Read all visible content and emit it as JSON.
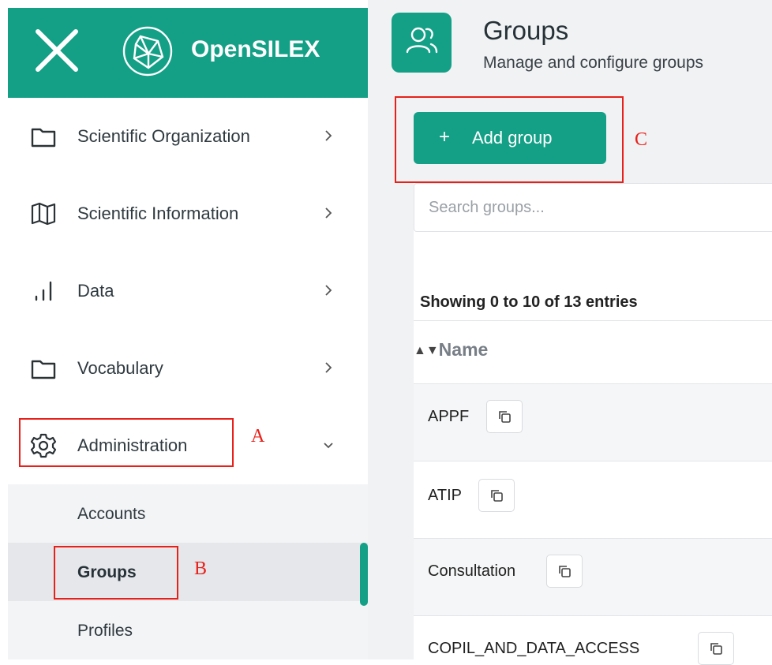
{
  "brand": {
    "name": "OpenSILEX",
    "close_icon": "close-icon",
    "logo_icon": "opensilex-logo-icon",
    "color": "#14a086"
  },
  "sidebar": {
    "items": [
      {
        "label": "Scientific Organization",
        "icon": "folder-icon",
        "chevron": "chevron-right-icon"
      },
      {
        "label": "Scientific Information",
        "icon": "map-icon",
        "chevron": "chevron-right-icon"
      },
      {
        "label": "Data",
        "icon": "bar-chart-icon",
        "chevron": "chevron-right-icon"
      },
      {
        "label": "Vocabulary",
        "icon": "folder-icon",
        "chevron": "chevron-right-icon"
      },
      {
        "label": "Administration",
        "icon": "gear-icon",
        "chevron": "chevron-down-icon"
      }
    ],
    "submenu": [
      {
        "label": "Accounts"
      },
      {
        "label": "Groups",
        "active": true
      },
      {
        "label": "Profiles"
      }
    ]
  },
  "header": {
    "title": "Groups",
    "subtitle": "Manage and configure groups",
    "icon": "users-icon"
  },
  "toolbar": {
    "add_label": "Add group",
    "add_icon": "plus"
  },
  "search": {
    "placeholder": "Search groups..."
  },
  "table": {
    "entries_info": "Showing 0 to 10 of 13 entries",
    "column": "Name",
    "sort_icon": "sort-icon",
    "rows": [
      {
        "name": "APPF"
      },
      {
        "name": "ATIP"
      },
      {
        "name": "Consultation"
      },
      {
        "name": "COPIL_AND_DATA_ACCESS"
      }
    ]
  },
  "annotations": {
    "a": "A",
    "b": "B",
    "c": "C",
    "color": "#e8201a"
  }
}
